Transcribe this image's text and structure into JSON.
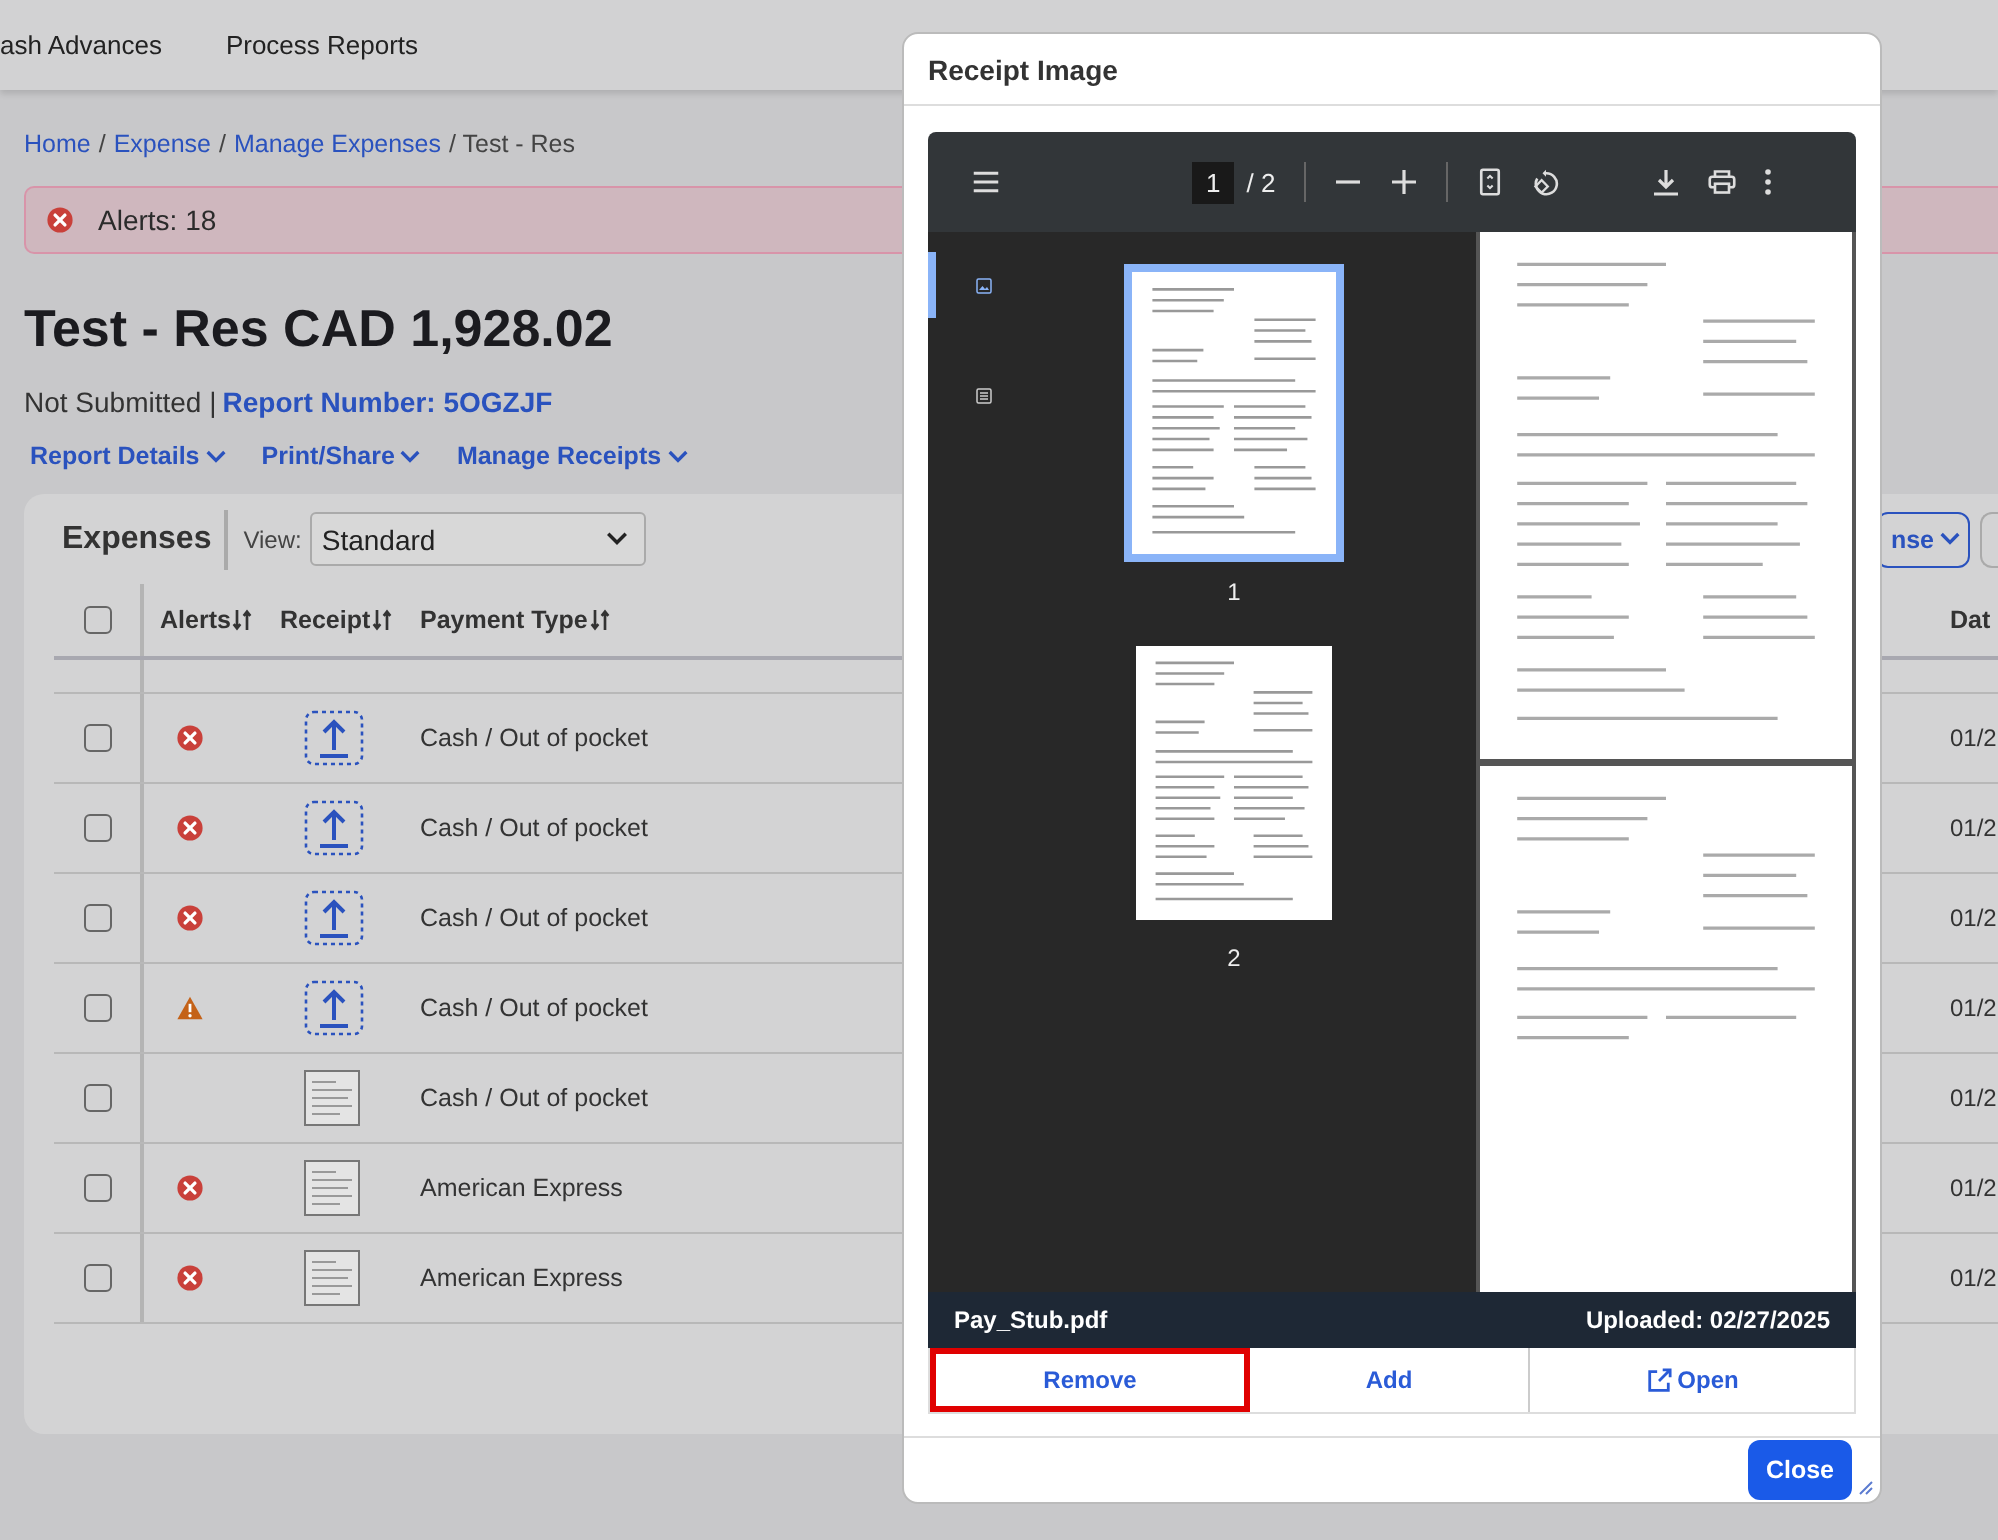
{
  "nav": {
    "items": [
      {
        "label": "ash Advances"
      },
      {
        "label": "Process Reports"
      }
    ]
  },
  "breadcrumb": [
    {
      "label": "Home",
      "kind": "link"
    },
    {
      "label": "/",
      "kind": "separator"
    },
    {
      "label": "Expense",
      "kind": "link"
    },
    {
      "label": "/",
      "kind": "separator"
    },
    {
      "label": "Manage Expenses",
      "kind": "link"
    },
    {
      "label": "/ Test - Res",
      "kind": "current"
    }
  ],
  "alert": {
    "text": "Alerts: 18"
  },
  "report": {
    "title": "Test - Res CAD 1,928.02",
    "status": "Not Submitted |",
    "number": "Report Number: 5OGZJF"
  },
  "menus": [
    "Report Details",
    "Print/Share",
    "Manage Receipts"
  ],
  "expenses": {
    "title": "Expenses",
    "view_label": "View:",
    "view_value": "Standard",
    "add_button": "nse",
    "columns": [
      {
        "label": "Alerts",
        "sortable": true
      },
      {
        "label": "Receipt",
        "sortable": true
      },
      {
        "label": "Payment Type",
        "sortable": true
      },
      {
        "label": "Dat",
        "sortable": false
      }
    ],
    "select_all": {
      "checked": false
    },
    "rows": [
      {
        "checked": false,
        "error": true,
        "warning": false,
        "receipt_attached": false,
        "payment_type": "Cash / Out of pocket",
        "date": "01/2"
      },
      {
        "checked": false,
        "error": true,
        "warning": false,
        "receipt_attached": false,
        "payment_type": "Cash / Out of pocket",
        "date": "01/2"
      },
      {
        "checked": false,
        "error": true,
        "warning": false,
        "receipt_attached": false,
        "payment_type": "Cash / Out of pocket",
        "date": "01/2"
      },
      {
        "checked": false,
        "error": false,
        "warning": true,
        "receipt_attached": false,
        "payment_type": "Cash / Out of pocket",
        "date": "01/2"
      },
      {
        "checked": false,
        "error": false,
        "warning": false,
        "receipt_attached": true,
        "payment_type": "Cash / Out of pocket",
        "date": "01/2"
      },
      {
        "checked": false,
        "error": true,
        "warning": false,
        "receipt_attached": true,
        "payment_type": "American Express",
        "date": "01/2"
      },
      {
        "checked": false,
        "error": true,
        "warning": false,
        "receipt_attached": true,
        "payment_type": "American Express",
        "date": "01/2"
      }
    ]
  },
  "dialog": {
    "title": "Receipt Image",
    "viewer": {
      "page": "1",
      "total": "/ 2",
      "sidebar_tabs": [
        {
          "kind": "thumbnails",
          "selected": true
        },
        {
          "kind": "outline",
          "selected": false
        }
      ],
      "thumbnails": [
        {
          "label": "1",
          "selected": true
        },
        {
          "label": "2",
          "selected": false
        }
      ],
      "file_name": "Pay_Stub.pdf",
      "uploaded": "Uploaded: 02/27/2025"
    },
    "actions": [
      {
        "label": "Remove",
        "kind": "plain",
        "highlighted": true
      },
      {
        "label": "Add",
        "kind": "plain",
        "highlighted": false
      },
      {
        "label": "Open",
        "kind": "open",
        "highlighted": false
      }
    ],
    "close": "Close"
  }
}
